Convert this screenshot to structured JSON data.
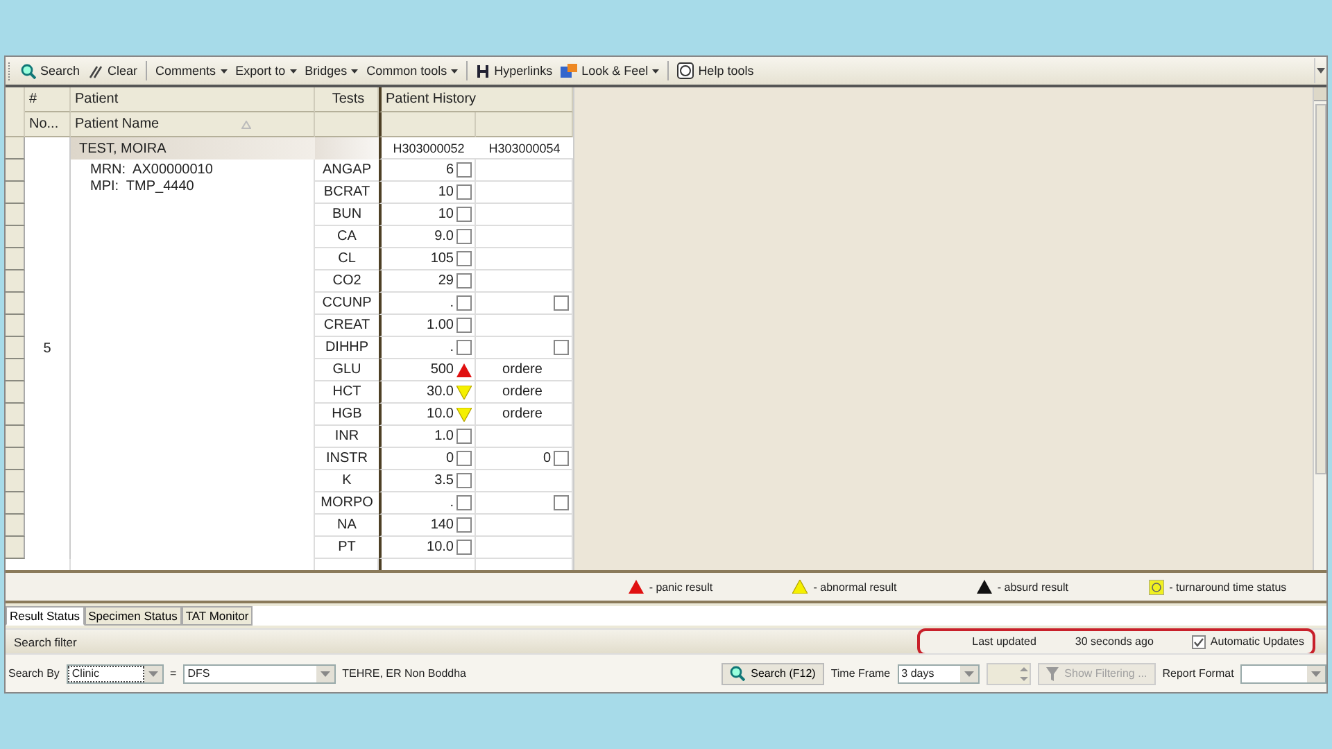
{
  "toolbar": [
    {
      "label": "Search",
      "dropdown": false
    },
    {
      "label": "Clear",
      "dropdown": false
    },
    {
      "label": "Comments",
      "dropdown": true
    },
    {
      "label": "Export to",
      "dropdown": true
    },
    {
      "label": "Bridges",
      "dropdown": true
    },
    {
      "label": "Common tools",
      "dropdown": true
    },
    {
      "label": "Hyperlinks",
      "dropdown": false
    },
    {
      "label": "Look & Feel",
      "dropdown": true
    },
    {
      "label": "Help tools",
      "dropdown": false
    }
  ],
  "grid": {
    "group_headers": [
      "#",
      "Patient",
      "Tests",
      "Patient History"
    ],
    "sub_headers": [
      "No...",
      "Patient Name"
    ],
    "accessions": [
      "H303000052",
      "H303000054"
    ],
    "patient": {
      "number": "5",
      "name": "TEST, MOIRA",
      "details": [
        "MRN:  AX00000010",
        "MPI:  TMP_4440"
      ]
    },
    "results": [
      {
        "test": "ANGAP",
        "history": [
          {
            "value": "6",
            "kind": "check",
            "checked": false
          }
        ]
      },
      {
        "test": "BCRAT",
        "history": [
          {
            "value": "10",
            "kind": "check",
            "checked": false
          }
        ]
      },
      {
        "test": "BUN",
        "history": [
          {
            "value": "10",
            "kind": "check",
            "checked": false
          }
        ]
      },
      {
        "test": "CA",
        "history": [
          {
            "value": "9.0",
            "kind": "check",
            "checked": false
          }
        ]
      },
      {
        "test": "CL",
        "history": [
          {
            "value": "105",
            "kind": "check",
            "checked": false
          }
        ]
      },
      {
        "test": "CO2",
        "history": [
          {
            "value": "29",
            "kind": "check",
            "checked": false
          }
        ]
      },
      {
        "test": "CCUNP",
        "history": [
          {
            "value": ".",
            "kind": "check",
            "checked": false
          },
          {
            "kind": "check",
            "checked": false
          }
        ]
      },
      {
        "test": "CREAT",
        "history": [
          {
            "value": "1.00",
            "kind": "check",
            "checked": false
          }
        ]
      },
      {
        "test": "DIHHP",
        "history": [
          {
            "value": ".",
            "kind": "check",
            "checked": false
          },
          {
            "kind": "check",
            "checked": false
          }
        ]
      },
      {
        "test": "GLU",
        "history": [
          {
            "value": "500",
            "kind": "panic"
          },
          {
            "value": "ordere",
            "kind": "text"
          }
        ]
      },
      {
        "test": "HCT",
        "history": [
          {
            "value": "30.0",
            "kind": "abnormal"
          },
          {
            "value": "ordere",
            "kind": "text"
          }
        ]
      },
      {
        "test": "HGB",
        "history": [
          {
            "value": "10.0",
            "kind": "abnormal"
          },
          {
            "value": "ordere",
            "kind": "text"
          }
        ]
      },
      {
        "test": "INR",
        "history": [
          {
            "value": "1.0",
            "kind": "check",
            "checked": false
          }
        ]
      },
      {
        "test": "INSTR",
        "history": [
          {
            "value": "0",
            "kind": "check",
            "checked": false
          },
          {
            "value": "0",
            "kind": "check",
            "checked": false
          }
        ]
      },
      {
        "test": "K",
        "history": [
          {
            "value": "3.5",
            "kind": "check",
            "checked": false
          }
        ]
      },
      {
        "test": "MORPO",
        "history": [
          {
            "value": ".",
            "kind": "check",
            "checked": false
          },
          {
            "kind": "check",
            "checked": false
          }
        ]
      },
      {
        "test": "NA",
        "history": [
          {
            "value": "140",
            "kind": "check",
            "checked": false
          }
        ]
      },
      {
        "test": "PT",
        "history": [
          {
            "value": "10.0",
            "kind": "check",
            "checked": false
          }
        ]
      }
    ]
  },
  "legend": [
    {
      "kind": "panic",
      "text": "- panic result"
    },
    {
      "kind": "abnormal",
      "text": "- abnormal result"
    },
    {
      "kind": "absurd",
      "text": "- absurd result"
    },
    {
      "kind": "tat",
      "text": "- turnaround time status"
    }
  ],
  "tabs": [
    {
      "label": "Result Status",
      "selected": true
    },
    {
      "label": "Specimen Status",
      "selected": false
    },
    {
      "label": "TAT Monitor",
      "selected": false
    }
  ],
  "search_filter": {
    "title": "Search filter",
    "last_updated_label": "Last updated",
    "last_updated": "30 seconds ago",
    "auto_update": {
      "label": "Automatic Updates",
      "checked": true
    }
  },
  "filter_row": {
    "search_by_label": "Search By",
    "search_by": "Clinic",
    "equals": "=",
    "search_value": "DFS",
    "search_value_text": "TEHRE, ER Non Boddha",
    "search_button": "Search (F12)",
    "time_frame_label": "Time Frame",
    "time_frame": "3 days",
    "show_filtering": {
      "label": "Show Filtering ...",
      "disabled": true
    },
    "report_format_label": "Report Format"
  }
}
